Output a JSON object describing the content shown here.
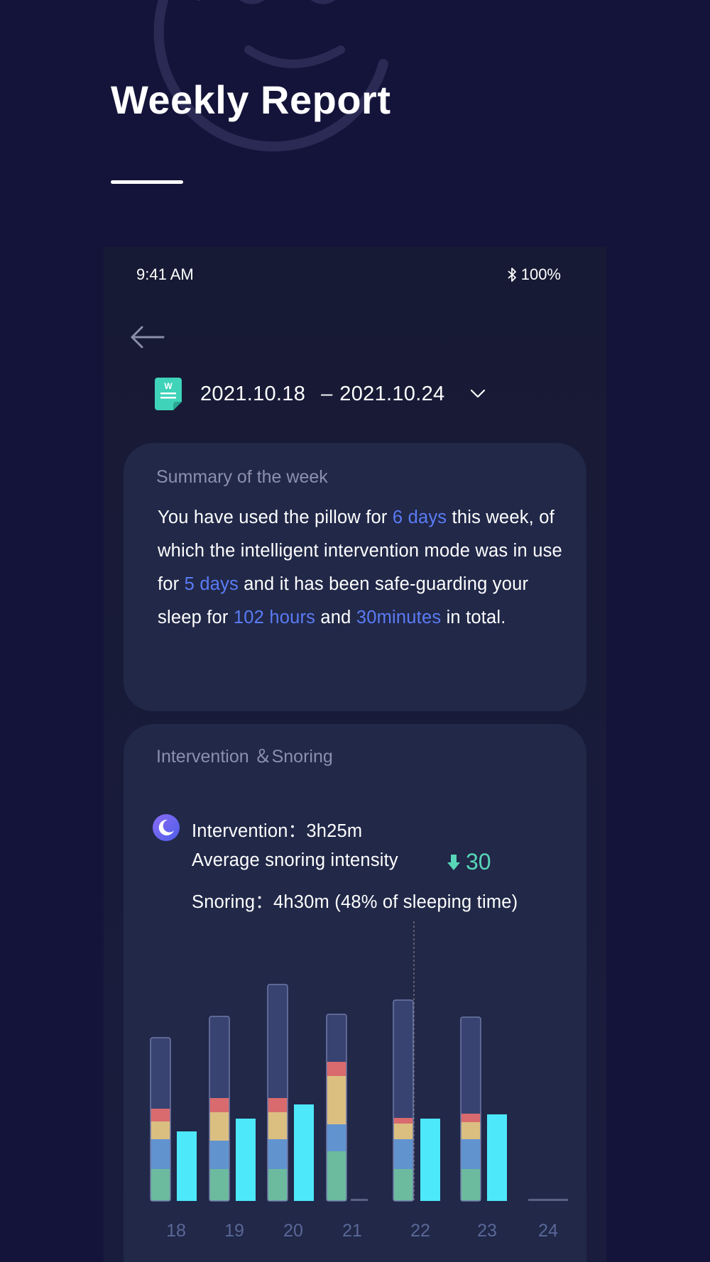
{
  "header": {
    "title": "Weekly Report"
  },
  "status_bar": {
    "time": "9:41 AM",
    "battery": "100%"
  },
  "date_range": {
    "start": "2021.10.18",
    "separator": "–",
    "end": "2021.10.24"
  },
  "summary": {
    "label": "Summary of the week",
    "segments": [
      {
        "text": "You have used the pillow for ",
        "highlight": false
      },
      {
        "text": "6 days",
        "highlight": true
      },
      {
        "text": " this week, of which the intelligent intervention mode was in use for ",
        "highlight": false
      },
      {
        "text": "5 days",
        "highlight": true
      },
      {
        "text": " and it has been safe-guarding your sleep for ",
        "highlight": false
      },
      {
        "text": "102 hours",
        "highlight": true
      },
      {
        "text": " and ",
        "highlight": false
      },
      {
        "text": "30minutes",
        "highlight": true
      },
      {
        "text": " in total.",
        "highlight": false
      }
    ]
  },
  "intervention": {
    "label": "Intervention ＆Snoring",
    "intervention_line": "Intervention：3h25m",
    "avg_label": "Average snoring intensity",
    "avg_value": "30",
    "snoring_line": "Snoring：4h30m (48% of sleeping time)"
  },
  "colors": {
    "background": "#14143a",
    "card": "#212848",
    "highlight": "#5b7bf4",
    "teal": "#58d6b8",
    "cyan_bar": "#4ee8fb",
    "stage_awake": "#384371",
    "stage_red": "#d96b6e",
    "stage_yellow": "#dbbf81",
    "stage_blue": "#6193cf",
    "stage_green": "#6cbb9e"
  },
  "chart_data": {
    "type": "bar",
    "categories": [
      "18",
      "19",
      "20",
      "21",
      "22",
      "23",
      "24"
    ],
    "stacked_series_order": [
      "green",
      "blue",
      "yellow",
      "red",
      "awake"
    ],
    "stacked": [
      {
        "green": 45,
        "blue": 42,
        "yellow": 25,
        "red": 18,
        "awake": 100
      },
      {
        "green": 45,
        "blue": 40,
        "yellow": 40,
        "red": 20,
        "awake": 115
      },
      {
        "green": 45,
        "blue": 42,
        "yellow": 38,
        "red": 20,
        "awake": 160
      },
      {
        "green": 70,
        "blue": 38,
        "yellow": 68,
        "red": 20,
        "awake": 67
      },
      {
        "green": 45,
        "blue": 42,
        "yellow": 22,
        "red": 8,
        "awake": 166
      },
      {
        "green": 45,
        "blue": 42,
        "yellow": 24,
        "red": 12,
        "awake": 136
      },
      null
    ],
    "cyan_values": [
      98,
      116,
      136,
      0,
      116,
      122,
      0
    ],
    "dashed_marker_category": "22"
  }
}
